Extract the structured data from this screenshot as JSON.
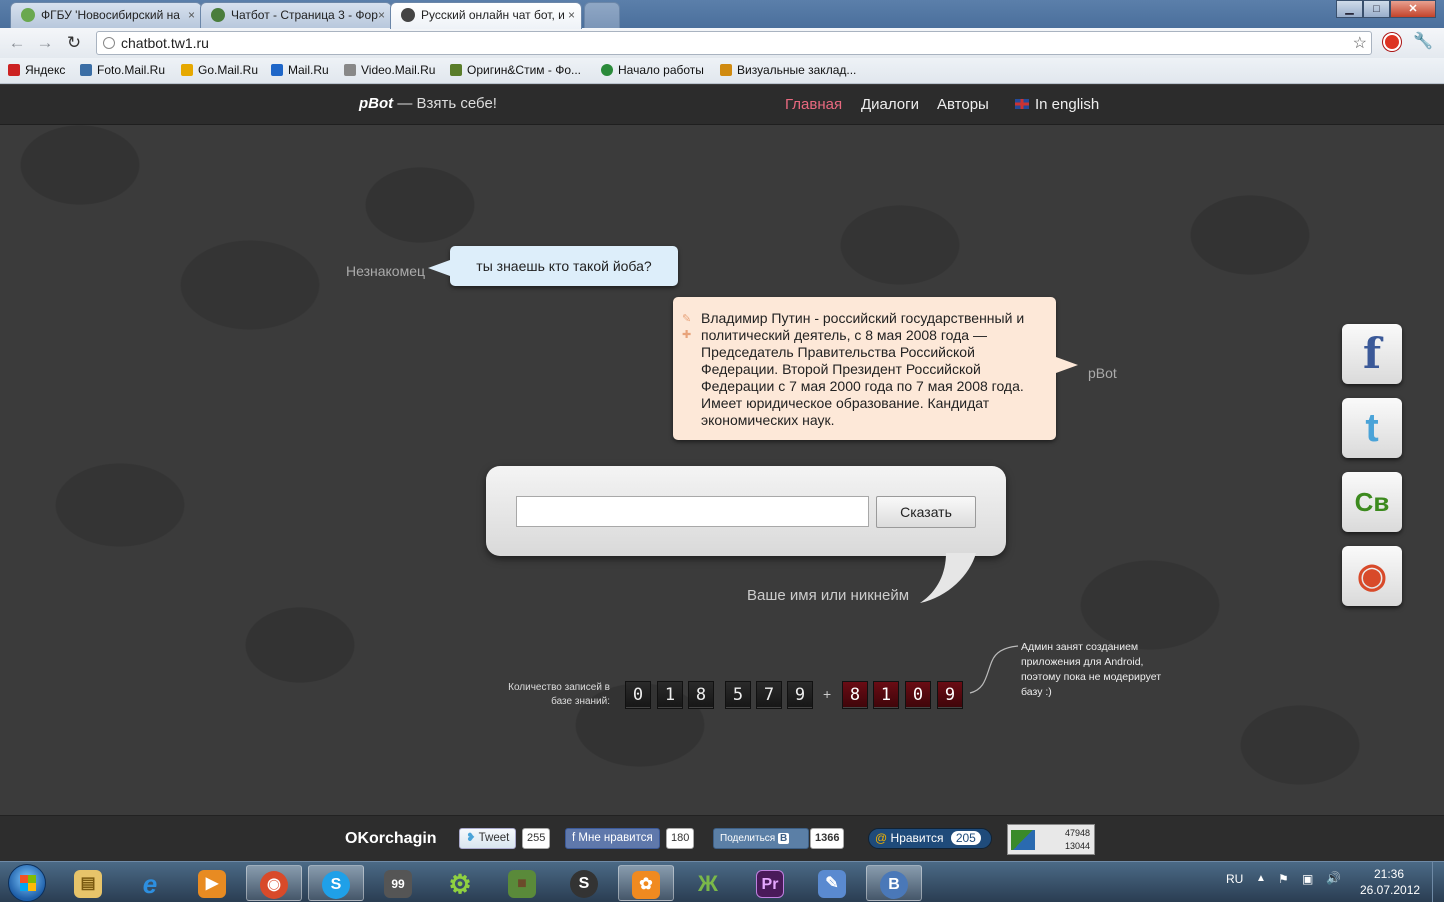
{
  "browser": {
    "tabs": [
      {
        "title": "ФГБУ 'Новосибирский на",
        "favicon_color": "#6aa84f"
      },
      {
        "title": "Чатбот - Страница 3 - Фор",
        "favicon_color": "#4a7d3c"
      },
      {
        "title": "Русский онлайн чат бот, и",
        "favicon_color": "#444444"
      }
    ],
    "close_glyph": "×",
    "window_buttons": {
      "minimize": "▁",
      "maximize": "□",
      "close": "✕"
    },
    "url": "chatbot.tw1.ru",
    "back_glyph": "←",
    "forward_glyph": "→",
    "reload_glyph": "↻",
    "star_glyph": "☆",
    "wrench_glyph": "🔧",
    "bookmarks": [
      {
        "label": "Яндекс",
        "color": "#cc2222"
      },
      {
        "label": "Foto.Mail.Ru",
        "color": "#3b6ea5"
      },
      {
        "label": "Go.Mail.Ru",
        "color": "#e6a800"
      },
      {
        "label": "Mail.Ru",
        "color": "#1e66c8"
      },
      {
        "label": "Video.Mail.Ru",
        "color": "#888888"
      },
      {
        "label": "Оригин&Стим - Фо...",
        "color": "#5a7d2a"
      },
      {
        "label": "Начало работы",
        "color": "#2a8a3a"
      },
      {
        "label": "Визуальные заклад...",
        "color": "#d08a10"
      }
    ]
  },
  "site": {
    "brand_name": "pBot",
    "brand_tagline": "— Взять себе!",
    "nav": [
      {
        "label": "Главная",
        "active": true
      },
      {
        "label": "Диалоги",
        "active": false
      },
      {
        "label": "Авторы",
        "active": false
      },
      {
        "label": "In english",
        "active": false
      }
    ]
  },
  "chat": {
    "user_name": "Незнакомец",
    "user_message": "ты знаешь кто такой йоба?",
    "bot_name": "pBot",
    "bot_message": "Владимир Путин - российский государственный и политический деятель, с 8 мая 2008 года — Председатель Правительства Российской Федерации. Второй Президент Российской Федерации с 7 мая 2000 года по 7 мая 2008 года. Имеет юридическое образование. Кандидат экономических наук.",
    "input_value": "",
    "say_button": "Сказать",
    "nickname_label": "Ваше имя или никнейм"
  },
  "knowledge": {
    "label": "Количество записей в базе знаний:",
    "digits": [
      "0",
      "1",
      "8",
      "5",
      "7",
      "9"
    ],
    "plus": "+",
    "pending_digits": [
      "8",
      "1",
      "0",
      "9"
    ],
    "admin_note": "Админ занят созданием приложения для Android, поэтому пока не модерирует базу :)"
  },
  "social_buttons": [
    {
      "name": "facebook",
      "glyph": "f",
      "color": "#3b5998"
    },
    {
      "name": "twitter",
      "glyph": "t",
      "color": "#4aa3d8"
    },
    {
      "name": "vkontakte-cb",
      "glyph": "Св",
      "color": "#3c8a1e"
    },
    {
      "name": "chrome-store",
      "glyph": "◉",
      "color": "#d84a2a"
    }
  ],
  "footer": {
    "brand": "OKorchagin",
    "tweet_label": "Tweet",
    "tweet_count": "255",
    "fb_like_label": "Мне нравится",
    "fb_like_count": "180",
    "vk_share_label": "Поделиться",
    "vk_share_count": "1366",
    "mailru_like_label": "Нравится",
    "mailru_like_count": "205",
    "stats_top": "47948",
    "stats_bottom": "13044"
  },
  "taskbar": {
    "apps": [
      {
        "name": "explorer",
        "glyph": "▤",
        "color": "#e7c46a",
        "open": false
      },
      {
        "name": "internet-explorer",
        "glyph": "e",
        "color": "#2d8fe0",
        "open": false
      },
      {
        "name": "media-player",
        "glyph": "▶",
        "color": "#e88b22",
        "open": false
      },
      {
        "name": "chrome",
        "glyph": "◉",
        "color": "#d84a2a",
        "open": true
      },
      {
        "name": "skype",
        "glyph": "S",
        "color": "#1fa0e8",
        "open": true
      },
      {
        "name": "app-99",
        "glyph": "99",
        "color": "#555555",
        "open": false
      },
      {
        "name": "gear",
        "glyph": "⚙",
        "color": "#6a9e2a",
        "open": false
      },
      {
        "name": "minecraft",
        "glyph": "■",
        "color": "#5a8a3a",
        "open": false
      },
      {
        "name": "steam",
        "glyph": "S",
        "color": "#333333",
        "open": false
      },
      {
        "name": "icq",
        "glyph": "✿",
        "color": "#f08a20",
        "open": true
      },
      {
        "name": "butterfly",
        "glyph": "Ж",
        "color": "#7ab84a",
        "open": false
      },
      {
        "name": "premiere",
        "glyph": "Pr",
        "color": "#4a1a5a",
        "open": false
      },
      {
        "name": "paint",
        "glyph": "✎",
        "color": "#5a8ad0",
        "open": false
      },
      {
        "name": "b-app",
        "glyph": "B",
        "color": "#4a78b8",
        "open": true
      }
    ],
    "language": "RU",
    "time": "21:36",
    "date": "26.07.2012"
  }
}
